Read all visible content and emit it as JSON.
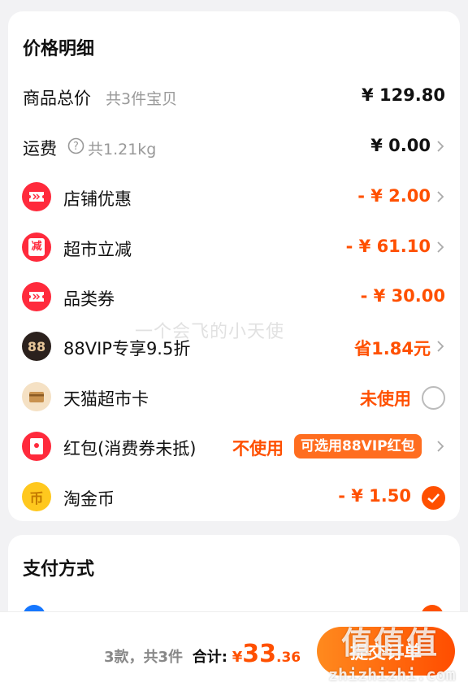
{
  "price_detail": {
    "title": "价格明细",
    "goods_total": {
      "label": "商品总价",
      "sub": "共3件宝贝",
      "value": "¥ 129.80"
    },
    "shipping": {
      "label": "运费",
      "sub": "共1.21kg",
      "value": "¥ 0.00"
    },
    "shop_discount": {
      "label": "店铺优惠",
      "value": "- ¥ 2.00"
    },
    "market_discount": {
      "label": "超市立减",
      "value": "- ¥ 61.10",
      "icon_text": "减"
    },
    "category_coupon": {
      "label": "品类券",
      "value": "- ¥ 30.00"
    },
    "vip": {
      "label": "88VIP专享9.5折",
      "value": "省1.84元",
      "icon_text": "88"
    },
    "tmall_card": {
      "label": "天猫超市卡",
      "value": "未使用"
    },
    "red_packet": {
      "label": "红包(消费券未抵)",
      "value": "不使用",
      "tag": "可选用88VIP红包"
    },
    "taojinbi": {
      "label": "淘金币",
      "value": "- ¥ 1.50",
      "icon_text": "币"
    }
  },
  "watermark": "一个会飞的小天使",
  "payment": {
    "title": "支付方式"
  },
  "bottom": {
    "count_text": "3款，共3件",
    "total_label": "合计:",
    "currency": "¥",
    "total_int": "33",
    "total_dec": ".36",
    "submit_label": "提交订单"
  },
  "logo": {
    "text": "值值值",
    "url": "zhizhizhi.com"
  },
  "colors": {
    "accent": "#ff5000",
    "background": "#f2f2f4",
    "card": "#ffffff"
  }
}
